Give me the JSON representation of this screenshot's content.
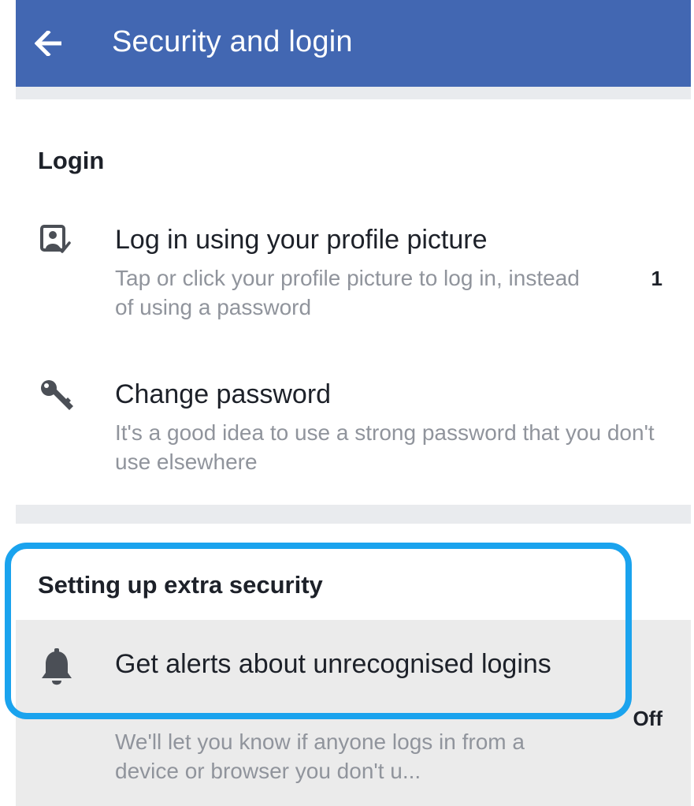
{
  "header": {
    "title": "Security and login",
    "background_color": "#4267b2",
    "back_icon": "arrow-left-icon"
  },
  "sections": [
    {
      "title": "Login",
      "items": [
        {
          "icon": "profile-picture-check-icon",
          "title": "Log in using your profile picture",
          "description": "Tap or click your profile picture to log in, instead of using a password",
          "value": "1"
        },
        {
          "icon": "key-icon",
          "title": "Change password",
          "description": "It's a good idea to use a strong password that you don't use elsewhere"
        }
      ]
    },
    {
      "title": "Setting up extra security",
      "items": [
        {
          "icon": "bell-icon",
          "title": "Get alerts about unrecognised logins",
          "description": "We'll let you know if anyone logs in from a device or browser you don't u...",
          "value": "Off"
        }
      ]
    }
  ],
  "colors": {
    "accent": "#4267b2",
    "highlight_outline": "#1aa3ee",
    "text_primary": "#1d2129",
    "text_secondary": "#90949c",
    "divider": "#e9ebee"
  }
}
